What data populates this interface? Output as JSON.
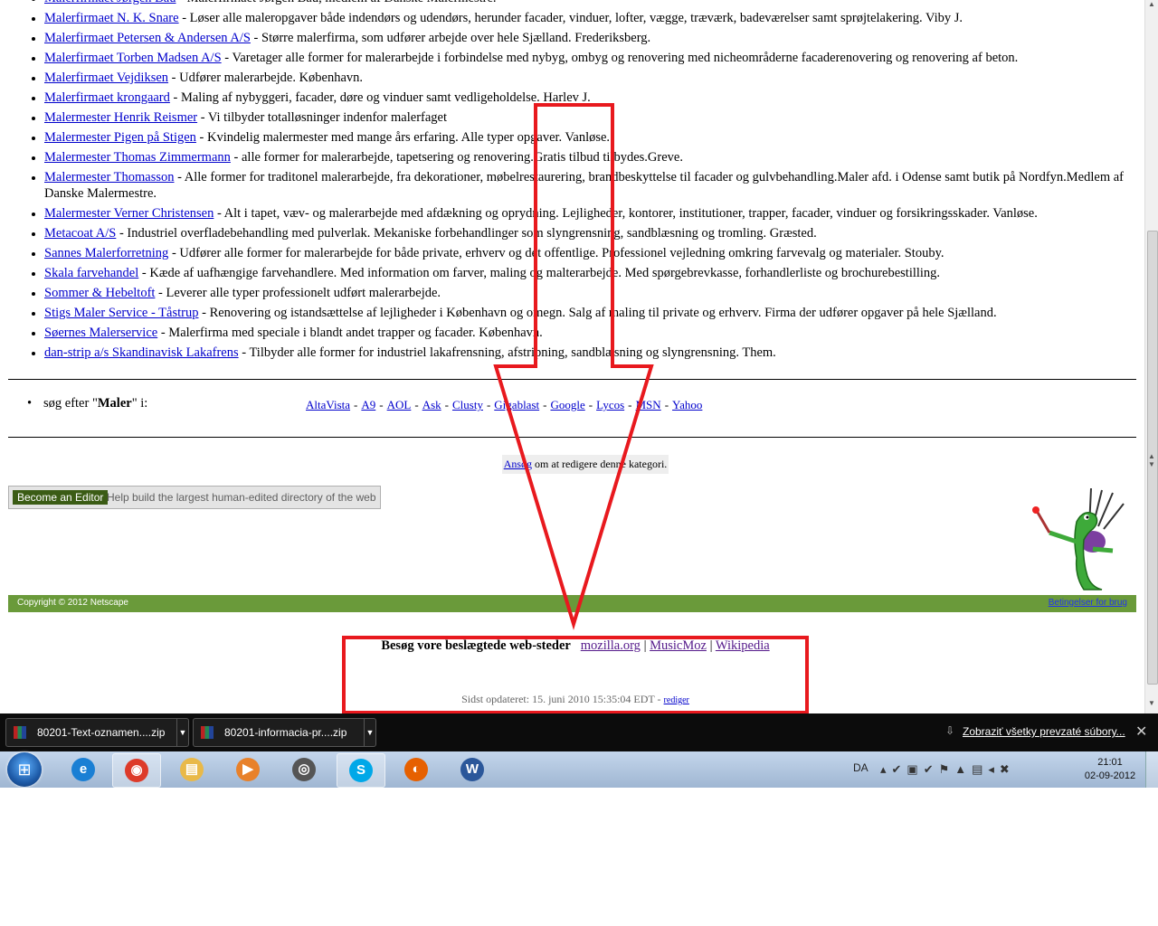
{
  "listings": [
    {
      "name": "Malerfirmaet Jørgen Bau",
      "desc": " - Malerfirmaet Jørgen Bau, medlem af Danske Malermestre."
    },
    {
      "name": "Malerfirmaet N. K. Snare",
      "desc": " - Løser alle maleropgaver både indendørs og udendørs, herunder facader, vinduer, lofter, vægge, træværk, badeværelser samt sprøjtelakering. Viby J."
    },
    {
      "name": "Malerfirmaet Petersen & Andersen A/S",
      "desc": " - Større malerfirma, som udfører arbejde over hele Sjælland. Frederiksberg."
    },
    {
      "name": "Malerfirmaet Torben Madsen A/S",
      "desc": " - Varetager alle former for malerarbejde i forbindelse med nybyg, ombyg og renovering med nicheområderne facaderenovering og renovering af beton."
    },
    {
      "name": "Malerfirmaet Vejdiksen",
      "desc": " - Udfører malerarbejde. København."
    },
    {
      "name": "Malerfirmaet krongaard",
      "desc": " - Maling af nybyggeri, facader, døre og vinduer samt vedligeholdelse. Harlev J."
    },
    {
      "name": "Malermester Henrik Reismer",
      "desc": " - Vi tilbyder totalløsninger indenfor malerfaget"
    },
    {
      "name": "Malermester Pigen på Stigen",
      "desc": " - Kvindelig malermester med mange års erfaring. Alle typer opgaver. Vanløse."
    },
    {
      "name": "Malermester Thomas Zimmermann",
      "desc": " - alle former for malerarbejde, tapetsering og renovering.Gratis tilbud tilbydes.Greve."
    },
    {
      "name": "Malermester Thomasson",
      "desc": " - Alle former for traditonel malerarbejde, fra dekorationer, møbelrestaurering, brandbeskyttelse til facader og gulvbehandling.Maler afd. i Odense samt butik på Nordfyn.Medlem af Danske Malermestre."
    },
    {
      "name": "Malermester Verner Christensen",
      "desc": " - Alt i tapet, væv- og malerarbejde med afdækning og oprydning. Lejligheder, kontorer, institutioner, trapper, facader, vinduer og forsikringsskader. Vanløse."
    },
    {
      "name": "Metacoat A/S",
      "desc": " - Industriel overfladebehandling med pulverlak. Mekaniske forbehandlinger som slyngrensning, sandblæsning og tromling. Græsted."
    },
    {
      "name": "Sannes Malerforretning",
      "desc": " - Udfører alle former for malerarbejde for både private, erhverv og det offentlige. Professionel vejledning omkring farvevalg og materialer. Stouby."
    },
    {
      "name": "Skala farvehandel",
      "desc": " - Kæde af uafhængige farvehandlere. Med information om farver, maling og malterarbejde. Med spørgebrevkasse, forhandlerliste og brochurebestilling."
    },
    {
      "name": "Sommer & Hebeltoft",
      "desc": " - Leverer alle typer professionelt udført malerarbejde."
    },
    {
      "name": "Stigs Maler Service - Tåstrup",
      "desc": " - Renovering og istandsættelse af lejligheder i København og omegn. Salg af maling til private og erhverv. Firma der udfører opgaver på hele Sjælland."
    },
    {
      "name": "Søernes Malerservice",
      "desc": " - Malerfirma med speciale i blandt andet trapper og facader. København."
    },
    {
      "name": "dan-strip a/s Skandinavisk Lakafrens",
      "desc": " - Tilbyder alle former for industriel lakafrensning, afstripning, sandblæsning og slyngrensning. Them."
    }
  ],
  "search": {
    "prefix": "søg efter \"",
    "term": "Maler",
    "suffix": "\" i:",
    "engines": [
      "AltaVista",
      "A9",
      "AOL",
      "Ask",
      "Clusty",
      "Gigablast",
      "Google",
      "Lycos",
      "MSN",
      "Yahoo"
    ],
    "separator": "-"
  },
  "request_edit": {
    "link": "Ansøg",
    "text": " om at redigere denne kategori."
  },
  "editor_banner": {
    "button": "Become an Editor",
    "tagline": "Help build the largest human-edited directory of the web"
  },
  "footer": {
    "copyright": "Copyright © 2012 Netscape",
    "terms": "Betingelser for brug"
  },
  "sister_sites": {
    "heading": "Besøg vore beslægtede web-steder",
    "links": [
      "mozilla.org",
      "MusicMoz",
      "Wikipedia"
    ],
    "separator": "|"
  },
  "last_updated": {
    "text": "Sidst opdateret: 15. juni 2010 15:35:04 EDT - ",
    "edit_link": "rediger"
  },
  "downloads": {
    "items": [
      "80201-Text-oznamen....zip",
      "80201-informacia-pr....zip"
    ],
    "show_all": "Zobraziť všetky prevzaté súbory...",
    "close": "✕"
  },
  "taskbar": {
    "apps": [
      {
        "icon": "internet-explorer-icon",
        "glyph": "e",
        "color": "#1a7fd4"
      },
      {
        "icon": "chrome-icon",
        "glyph": "◉",
        "color": "#dd3b2a"
      },
      {
        "icon": "file-explorer-icon",
        "glyph": "▤",
        "color": "#e9b949"
      },
      {
        "icon": "media-player-icon",
        "glyph": "▶",
        "color": "#e8812a"
      },
      {
        "icon": "webcam-icon",
        "glyph": "◎",
        "color": "#555555"
      },
      {
        "icon": "skype-icon",
        "glyph": "S",
        "color": "#00a8e8"
      },
      {
        "icon": "firefox-icon",
        "glyph": "◐",
        "color": "#e66000"
      },
      {
        "icon": "word-icon",
        "glyph": "W",
        "color": "#2b579a"
      }
    ],
    "lang": "DA",
    "time": "21:01",
    "date": "02-09-2012"
  },
  "colors": {
    "annotation": "#e8191e",
    "footer_bar": "#6a9a3a",
    "link": "#0000cc"
  }
}
